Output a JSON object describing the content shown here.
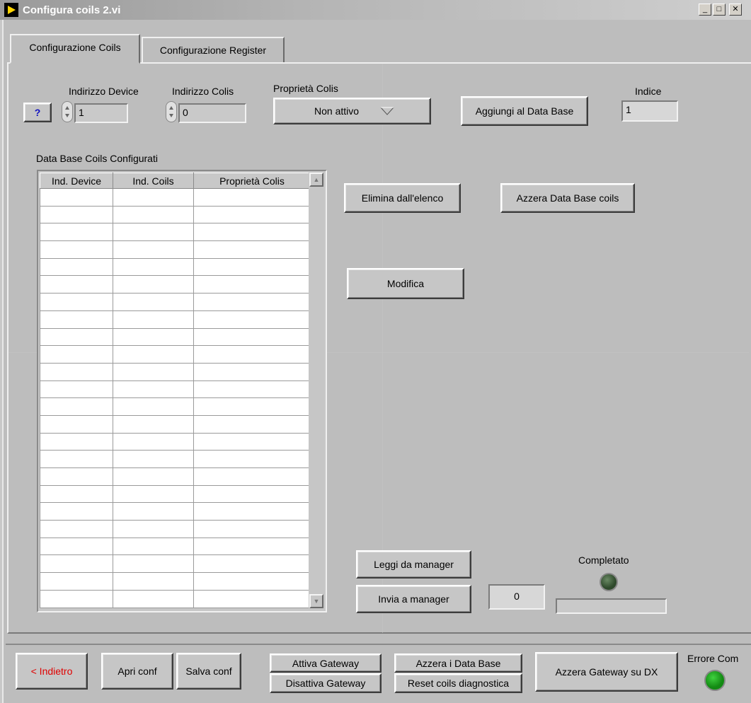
{
  "window": {
    "title": "Configura coils 2.vi",
    "minimize_glyph": "_",
    "maximize_glyph": "□",
    "close_glyph": "✕"
  },
  "tabs": [
    {
      "label": "Configurazione Coils",
      "active": true
    },
    {
      "label": "Configurazione Register",
      "active": false
    }
  ],
  "config": {
    "help_label": "?",
    "indirizzo_device_label": "Indirizzo Device",
    "indirizzo_device_value": "1",
    "indirizzo_colis_label": "Indirizzo Colis",
    "indirizzo_colis_value": "0",
    "proprieta_label": "Proprietà Colis",
    "proprieta_value": "Non attivo",
    "aggiungi_label": "Aggiungi al Data Base",
    "indice_label": "Indice",
    "indice_value": "1"
  },
  "database": {
    "label": "Data Base Coils Configurati",
    "columns": [
      "Ind. Device",
      "Ind. Coils",
      "Proprietà Colis"
    ],
    "row_count": 24
  },
  "actions": {
    "elimina_label": "Elimina dall'elenco",
    "azzera_db_label": "Azzera Data Base coils",
    "modifica_label": "Modifica",
    "leggi_label": "Leggi da manager",
    "invia_label": "Invia a manager",
    "counter_value": "0",
    "completato_label": "Completato",
    "progress": 0
  },
  "bottom": {
    "indietro_label": "< Indietro",
    "apri_label": "Apri conf",
    "salva_label": "Salva conf",
    "attiva_gateway_label": "Attiva Gateway",
    "disattiva_gateway_label": "Disattiva Gateway",
    "azzera_db_label": "Azzera i Data Base",
    "reset_coils_label": "Reset coils diagnostica",
    "azzera_gateway_label": "Azzera Gateway su DX",
    "errore_com_label": "Errore Com"
  },
  "colors": {
    "completato_led": "#2f4a2c",
    "errore_led": "#138a13",
    "indietro_text": "#e00000",
    "help_text": "#1010c0"
  }
}
